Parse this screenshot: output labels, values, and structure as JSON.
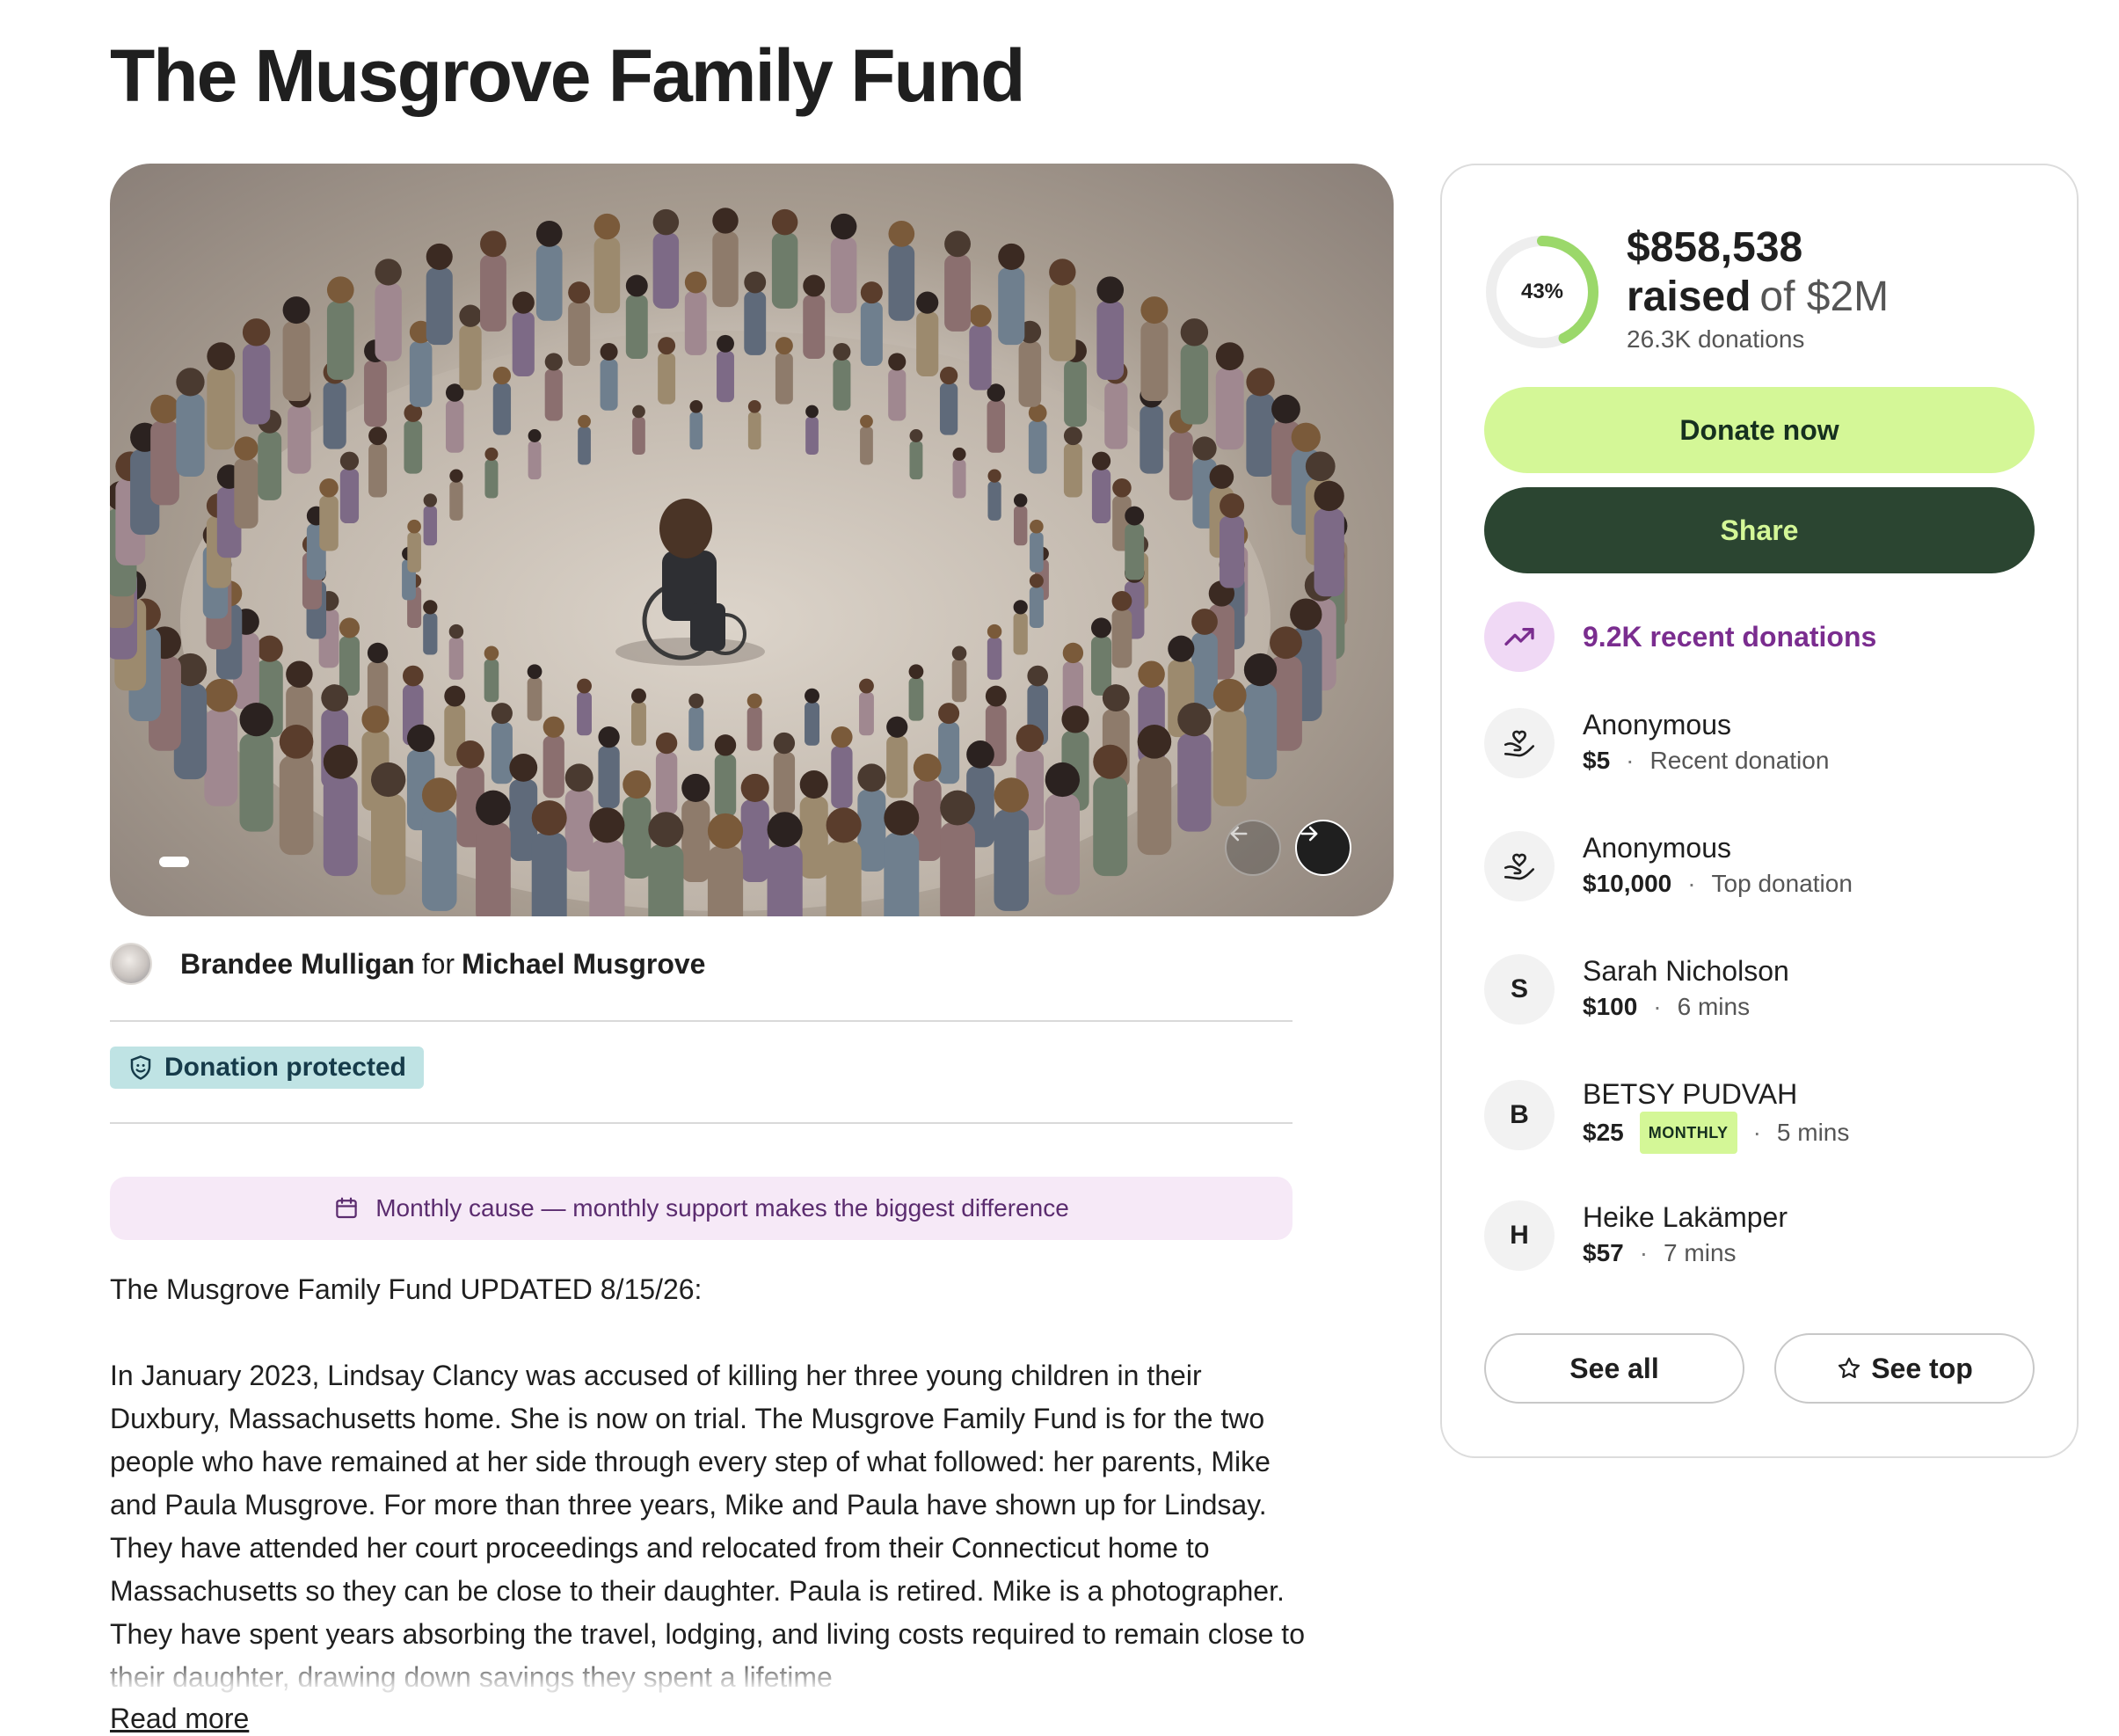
{
  "fundraiser": {
    "title": "The Musgrove Family Fund"
  },
  "organizer": {
    "name": "Brandee Mulligan",
    "connector": "for",
    "beneficiary": "Michael Musgrove"
  },
  "badges": {
    "protected": "Donation protected"
  },
  "monthly_banner": "Monthly cause — monthly support makes the biggest difference",
  "story": {
    "heading": "The Musgrove Family Fund UPDATED 8/15/26:",
    "body": "In January 2023, Lindsay Clancy was accused of killing her three young children in their Duxbury, Massachusetts home. She is now on trial. The Musgrove Family Fund is for the two people who have remained at her side through every step of what followed: her parents, Mike and Paula Musgrove. For more than three years, Mike and Paula have shown up for Lindsay. They have attended her court proceedings and relocated from their Connecticut home to Massachusetts so they can be close to their daughter. Paula is retired. Mike is a photographer. They have spent years absorbing the travel, lodging, and living costs required to remain close to their daughter, drawing down savings they spent a lifetime",
    "read_more": "Read more"
  },
  "carousel": {
    "current_slide": 1,
    "prev_icon": "arrow-left-icon",
    "next_icon": "arrow-right-icon"
  },
  "progress": {
    "percent_label": "43%",
    "percent": 43,
    "raised": "$858,538",
    "raised_word": "raised",
    "goal": "of $2M",
    "donations": "26.3K donations",
    "ring_color": "#9bd86a"
  },
  "actions": {
    "donate": "Donate now",
    "share": "Share",
    "see_all": "See all",
    "see_top": "See top"
  },
  "recent": {
    "label": "9.2K recent donations",
    "icon": "trending-up-icon"
  },
  "donors": [
    {
      "name": "Anonymous",
      "amount": "$5",
      "note": "Recent donation",
      "avatar": "heart-hand-icon"
    },
    {
      "name": "Anonymous",
      "amount": "$10,000",
      "note": "Top donation",
      "avatar": "heart-hand-icon"
    },
    {
      "name": "Sarah Nicholson",
      "amount": "$100",
      "note": "6 mins",
      "initial": "S"
    },
    {
      "name": "BETSY PUDVAH",
      "amount": "$25",
      "tag": "MONTHLY",
      "note": "5 mins",
      "initial": "B"
    },
    {
      "name": "Heike Lakämper",
      "amount": "$57",
      "note": "7 mins",
      "initial": "H"
    }
  ],
  "colors": {
    "donate_bg": "#d4f797",
    "share_bg": "#2b4531",
    "protected_bg": "#bfe3e4",
    "recent_purple": "#7a2d8f",
    "banner_bg": "#f6e9f7"
  }
}
